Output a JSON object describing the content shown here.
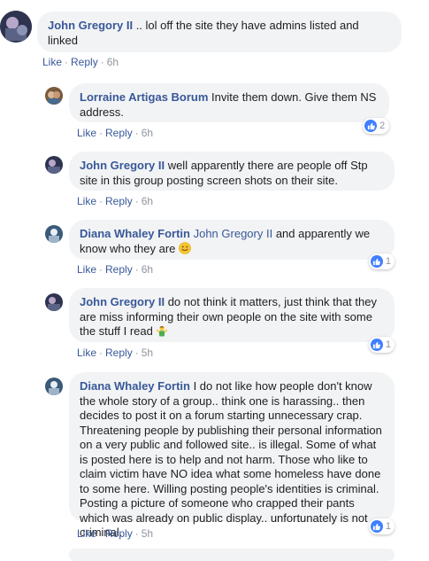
{
  "comments": [
    {
      "author": "John Gregory II",
      "text": " .. lol off the site they have admins listed and linked",
      "like": "Like",
      "reply": "Reply",
      "time": "6h"
    },
    {
      "author": "Lorraine Artigas Borum",
      "text": " Invite them down. Give them NS address.",
      "like": "Like",
      "reply": "Reply",
      "time": "6h",
      "reactions": "2"
    },
    {
      "author": "John Gregory II",
      "text": " well apparently there are people off Stp site in this group posting screen shots on their site.",
      "like": "Like",
      "reply": "Reply",
      "time": "6h"
    },
    {
      "author": "Diana Whaley Fortin",
      "mention": "John Gregory II",
      "text": " and apparently we know who they are ",
      "like": "Like",
      "reply": "Reply",
      "time": "6h",
      "reactions": "1"
    },
    {
      "author": "John Gregory II",
      "text": " do not think it matters, just think that they are miss informing their own people on the site with some the stuff I read ",
      "like": "Like",
      "reply": "Reply",
      "time": "5h",
      "reactions": "1"
    },
    {
      "author": "Diana Whaley Fortin",
      "text": " I do not like how people don't know the whole story of a group.. think one is harassing.. then decides to post it on a forum starting unnecessary crap. Threatening people by publishing their personal information on a very public and followed site.. is illegal. Some of what is posted here is to help and not harm. Those who like to claim victim have NO idea what some homeless have done to some here. Willing posting people's identities is criminal. Posting a picture of someone who crapped their pants which was already on public display.. unfortunately is not criminal.",
      "like": "Like",
      "reply": "Reply",
      "time": "5h",
      "reactions": "1"
    }
  ],
  "separator": "·",
  "colors": {
    "link": "#385898",
    "bubble": "#f2f3f5",
    "meta": "#90949c",
    "like_blue": "#4080ff"
  },
  "icons": {
    "like": "thumbs-up-icon",
    "smile": "smiling-face-icon",
    "shrug": "person-shrugging-icon"
  }
}
